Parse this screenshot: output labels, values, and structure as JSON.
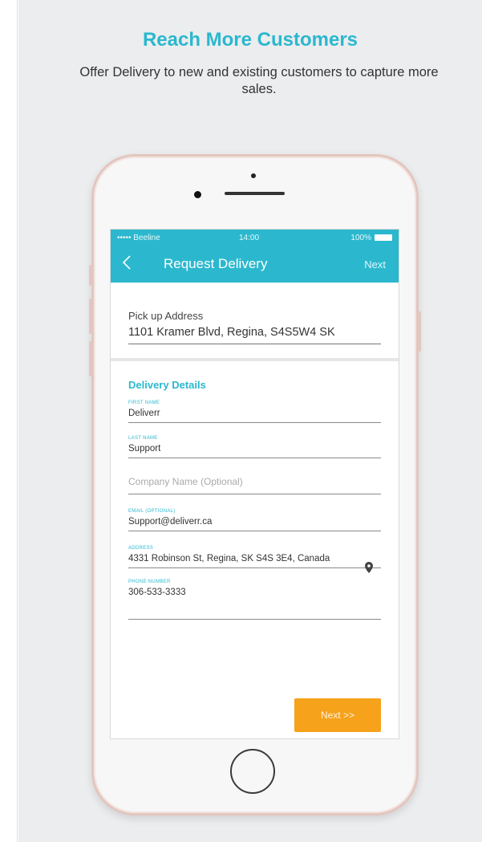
{
  "header": {
    "title": "Reach More Customers",
    "subtitle": "Offer Delivery to new and existing customers to capture more sales."
  },
  "status_bar": {
    "carrier": "••••• Beeline",
    "time": "14:00",
    "battery": "100%"
  },
  "nav": {
    "back_icon": "chevron-left-icon",
    "title": "Request Delivery",
    "next_label": "Next"
  },
  "pickup": {
    "label": "Pick up Address",
    "value": "1101 Kramer Blvd, Regina, S4S5W4 SK"
  },
  "delivery": {
    "section_title": "Delivery Details",
    "first_name": {
      "label": "FIRST NAME",
      "value": "Deliverr"
    },
    "last_name": {
      "label": "LAST NAME",
      "value": "Support"
    },
    "company": {
      "placeholder": "Company Name (Optional)"
    },
    "email": {
      "label": "EMAIL (OPTIONAL)",
      "value": "Support@deliverr.ca"
    },
    "address": {
      "label": "ADDRESS",
      "value": "4331 Robinson St, Regina, SK S4S 3E4, Canada",
      "icon": "map-pin-icon"
    },
    "phone": {
      "label": "PHONE NUMBER",
      "value": "306-533-3333"
    }
  },
  "footer": {
    "next_button": "Next >>"
  },
  "colors": {
    "accent": "#2bb8ce",
    "button": "#f6a21b",
    "background": "#ecedef",
    "phone_frame": "#e3c6bf"
  }
}
